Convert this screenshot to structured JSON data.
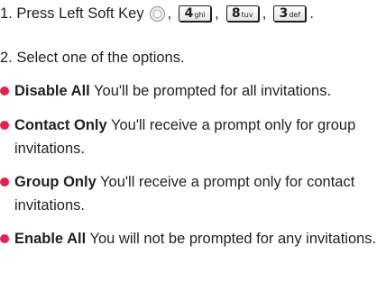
{
  "steps": {
    "step1_text": "1. Press Left Soft Key",
    "step1_keys": [
      {
        "icon": "left-soft-key-icon"
      },
      {
        "num": "4",
        "letters": "ghi"
      },
      {
        "num": "8",
        "letters": "tuv"
      },
      {
        "num": "3",
        "letters": "def"
      }
    ],
    "step1_separator": ",",
    "step1_end": ".",
    "step2_text": "2. Select one of the options."
  },
  "options": [
    {
      "term": "Disable All",
      "description": "You'll be prompted for all invitations."
    },
    {
      "term": "Contact Only",
      "description": "You'll receive a prompt only for group invitations."
    },
    {
      "term": "Group Only",
      "description": "You'll receive a prompt only for contact invitations."
    },
    {
      "term": "Enable All",
      "description": "You will not be prompted for any invitations."
    }
  ],
  "colors": {
    "bullet": "#e0234e",
    "text": "#231f20"
  }
}
